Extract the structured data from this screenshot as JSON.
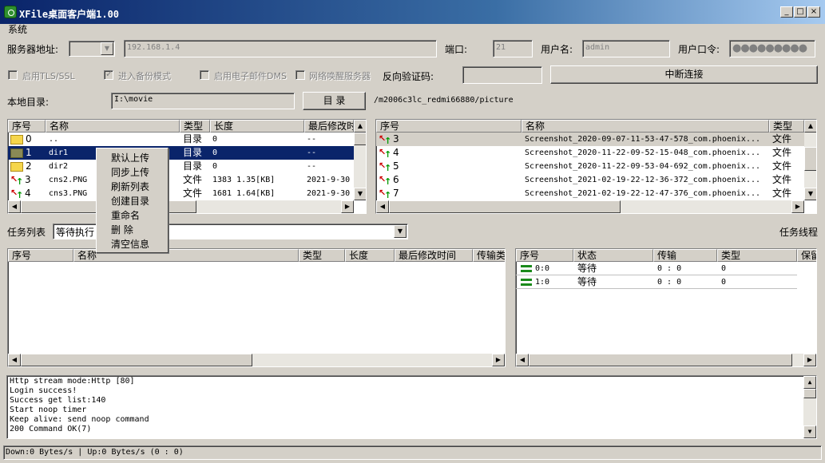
{
  "window": {
    "title": "XFile桌面客户端1.00",
    "min": "_",
    "max": "□",
    "close": "×"
  },
  "menu": {
    "system": "系统"
  },
  "server": {
    "addr_label": "服务器地址:",
    "ip_value": "192.168.1.4",
    "port_label": "端口:",
    "port_value": "21",
    "user_label": "用户名:",
    "user_value": "admin",
    "pass_label": "用户口令:",
    "pass_value": "●●●●●●●●●"
  },
  "options": {
    "tls_label": "启用TLS/SSL",
    "backup_label": "进入备份模式",
    "email_label": "启用电子邮件DMS",
    "wake_label": "网络唤醒服务器",
    "reverse_label": "反向验证码:",
    "disconnect_label": "中断连接"
  },
  "local_dir": {
    "label": "本地目录:",
    "value": "I:\\movie",
    "button": "目 录",
    "remote_path": "/m2006c3lc_redmi66880/picture"
  },
  "local_list": {
    "headers": [
      "序号",
      "名称",
      "类型",
      "长度",
      "最后修改时"
    ],
    "rows": [
      {
        "idx": "0",
        "name": "..",
        "type": "目录",
        "len": "0",
        "time": "--",
        "kind": "folder"
      },
      {
        "idx": "1",
        "name": "dir1",
        "type": "目录",
        "len": "0",
        "time": "--",
        "kind": "folder-dark"
      },
      {
        "idx": "2",
        "name": "dir2",
        "type": "目录",
        "len": "0",
        "time": "--",
        "kind": "folder"
      },
      {
        "idx": "3",
        "name": "cns2.PNG",
        "type": "文件",
        "len": "1383  1.35[KB]",
        "time": "2021-9-30",
        "kind": "file"
      },
      {
        "idx": "4",
        "name": "cns3.PNG",
        "type": "文件",
        "len": "1681  1.64[KB]",
        "time": "2021-9-30",
        "kind": "file"
      }
    ]
  },
  "remote_list": {
    "headers": [
      "序号",
      "名称",
      "类型"
    ],
    "rows": [
      {
        "idx": "3",
        "name": "Screenshot_2020-09-07-11-53-47-578_com.phoenix...",
        "type": "文件"
      },
      {
        "idx": "4",
        "name": "Screenshot_2020-11-22-09-52-15-048_com.phoenix...",
        "type": "文件"
      },
      {
        "idx": "5",
        "name": "Screenshot_2020-11-22-09-53-04-692_com.phoenix...",
        "type": "文件"
      },
      {
        "idx": "6",
        "name": "Screenshot_2021-02-19-22-12-36-372_com.phoenix...",
        "type": "文件"
      },
      {
        "idx": "7",
        "name": "Screenshot_2021-02-19-22-12-47-376_com.phoenix...",
        "type": "文件"
      }
    ]
  },
  "context_menu": [
    "默认上传",
    "同步上传",
    "刷新列表",
    "创建目录",
    "重命名",
    "删 除",
    "清空信息"
  ],
  "tasks": {
    "label": "任务列表",
    "filter": "等待执行",
    "headers": [
      "序号",
      "名称",
      "类型",
      "长度",
      "最后修改时间",
      "传输类"
    ]
  },
  "threads": {
    "label": "任务线程",
    "headers": [
      "序号",
      "状态",
      "传输",
      "类型",
      "保留"
    ],
    "rows": [
      {
        "idx": "0:0",
        "state": "等待",
        "transfer": "0 : 0",
        "type": "0"
      },
      {
        "idx": "1:0",
        "state": "等待",
        "transfer": "0 : 0",
        "type": "0"
      }
    ]
  },
  "log": [
    "Http stream mode:Http [80]",
    "Login success!",
    "Success get list:140",
    "Start noop timer",
    "Keep alive: send noop command",
    "200 Command OK(7)"
  ],
  "statusbar": "Down:0 Bytes/s | Up:0 Bytes/s (0 : 0)"
}
